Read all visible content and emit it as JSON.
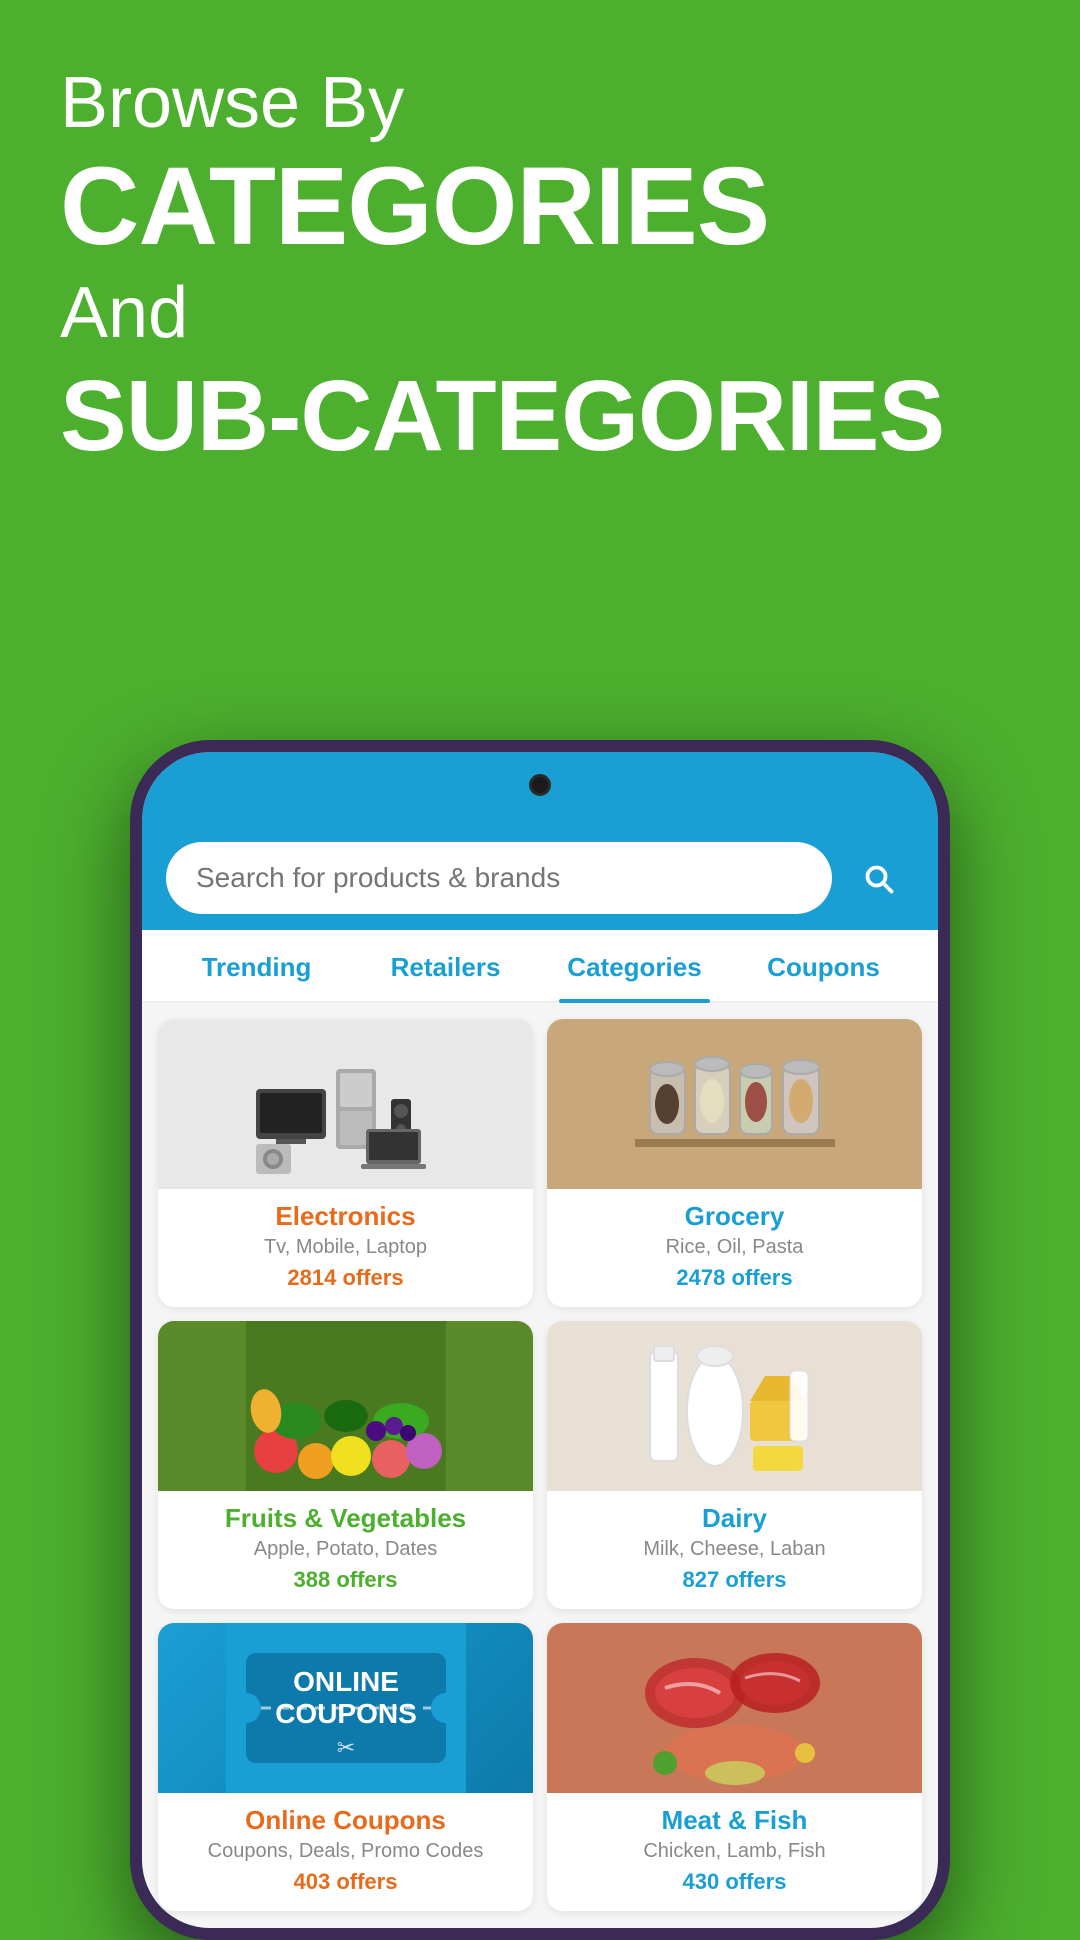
{
  "hero": {
    "browse_by": "Browse By",
    "categories_title": "CATEGORIES",
    "and_text": "And",
    "sub_categories_title": "SUB-CATEGORIES"
  },
  "app": {
    "search_placeholder": "Search for products & brands",
    "search_button_label": "Search"
  },
  "tabs": [
    {
      "id": "trending",
      "label": "Trending",
      "active": false
    },
    {
      "id": "retailers",
      "label": "Retailers",
      "active": false
    },
    {
      "id": "categories",
      "label": "Categories",
      "active": true
    },
    {
      "id": "coupons",
      "label": "Coupons",
      "active": false
    }
  ],
  "categories": [
    {
      "id": "electronics",
      "name": "Electronics",
      "sub": "Tv, Mobile, Laptop",
      "offers": "2814 offers",
      "color": "electronics"
    },
    {
      "id": "grocery",
      "name": "Grocery",
      "sub": "Rice, Oil, Pasta",
      "offers": "2478 offers",
      "color": "grocery"
    },
    {
      "id": "fruits",
      "name": "Fruits & Vegetables",
      "sub": "Apple, Potato, Dates",
      "offers": "388 offers",
      "color": "fruits"
    },
    {
      "id": "dairy",
      "name": "Dairy",
      "sub": "Milk, Cheese, Laban",
      "offers": "827 offers",
      "color": "dairy"
    },
    {
      "id": "online-coupons",
      "name": "Online Coupons",
      "sub": "Coupons, Deals, Promo Codes",
      "offers": "403 offers",
      "color": "coupons",
      "banner_line1": "ONLINE",
      "banner_line2": "COUPONS"
    },
    {
      "id": "meat",
      "name": "Meat & Fish",
      "sub": "Chicken, Lamb, Fish",
      "offers": "430 offers",
      "color": "meat"
    }
  ]
}
